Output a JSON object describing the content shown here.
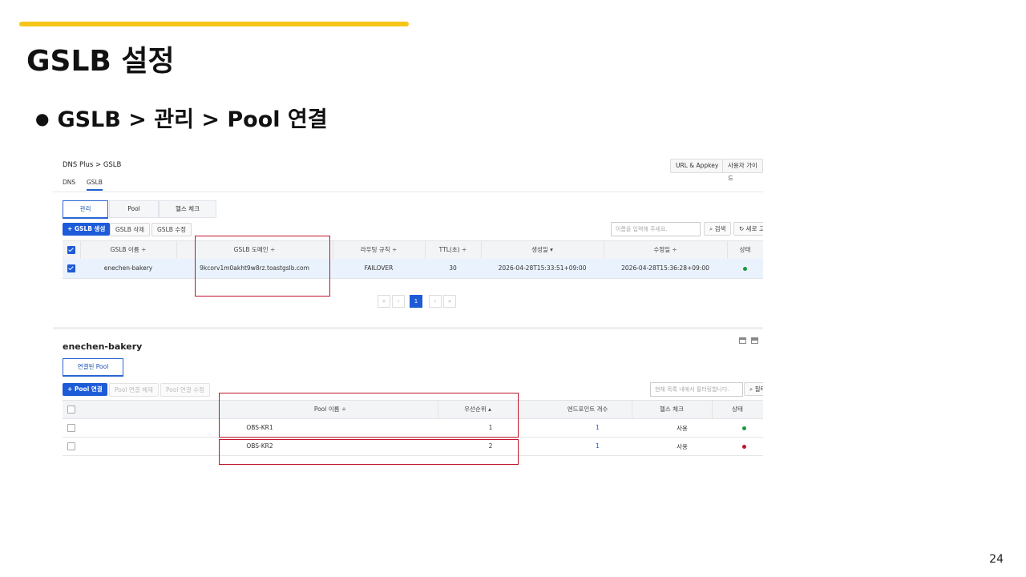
{
  "slide": {
    "title": "GSLB 설정",
    "bullet": "GSLB > 관리 > Pool 연결",
    "page_number": "24",
    "accent_color": "#f5c518",
    "highlight_color": "#c0142a"
  },
  "console": {
    "breadcrumb": "DNS Plus  >  GSLB",
    "top_buttons": {
      "appkey": "URL & Appkey",
      "guide": "사용자 가이드"
    },
    "subnav": {
      "dns": "DNS",
      "gslb": "GSLB"
    },
    "tabs": {
      "manage": "관리",
      "pool": "Pool",
      "health": "헬스 체크"
    },
    "toolbar": {
      "create": "+ GSLB 생성",
      "delete": "GSLB 삭제",
      "edit": "GSLB 수정",
      "search_placeholder": "이름을 입력해 주세요.",
      "search": "검색",
      "refresh": "새로 고"
    },
    "gslb_table": {
      "headers": {
        "name": "GSLB 이름 ÷",
        "domain": "GSLB 도메인 ÷",
        "routing": "라우팅 규칙 ÷",
        "ttl": "TTL(초) ÷",
        "created": "생성일 ▾",
        "modified": "수정일 ÷",
        "status": "상태"
      },
      "row": {
        "name": "enechen-bakery",
        "domain": "9kcorv1m0akht9w8rz.toastgslb.com",
        "routing": "FAILOVER",
        "ttl": "30",
        "created": "2026-04-28T15:33:51+09:00",
        "modified": "2026-04-28T15:36:28+09:00",
        "status_color": "#1a9a3c"
      }
    },
    "pager": {
      "first": "«",
      "prev": "‹",
      "current": "1",
      "next": "›",
      "last": "»"
    },
    "detail": {
      "title": "enechen-bakery",
      "tab": "연결된 Pool",
      "connect": "+ Pool 연결",
      "disconnect": "Pool 연결 해제",
      "modify": "Pool 연결 수정",
      "filter_placeholder": "현재 목록 내에서 필터링합니다.",
      "filter": "필터"
    },
    "pool_table": {
      "headers": {
        "name": "Pool 이름 ÷",
        "priority": "우선순위 ▴",
        "endpoints": "엔드포인트 개수",
        "health": "헬스 체크",
        "status": "상태"
      },
      "rows": [
        {
          "name": "OBS-KR1",
          "priority": "1",
          "endpoints": "1",
          "health": "사용",
          "status_color": "#1a9a3c"
        },
        {
          "name": "OBS-KR2",
          "priority": "2",
          "endpoints": "1",
          "health": "사용",
          "status_color": "#c0142a"
        }
      ]
    }
  }
}
